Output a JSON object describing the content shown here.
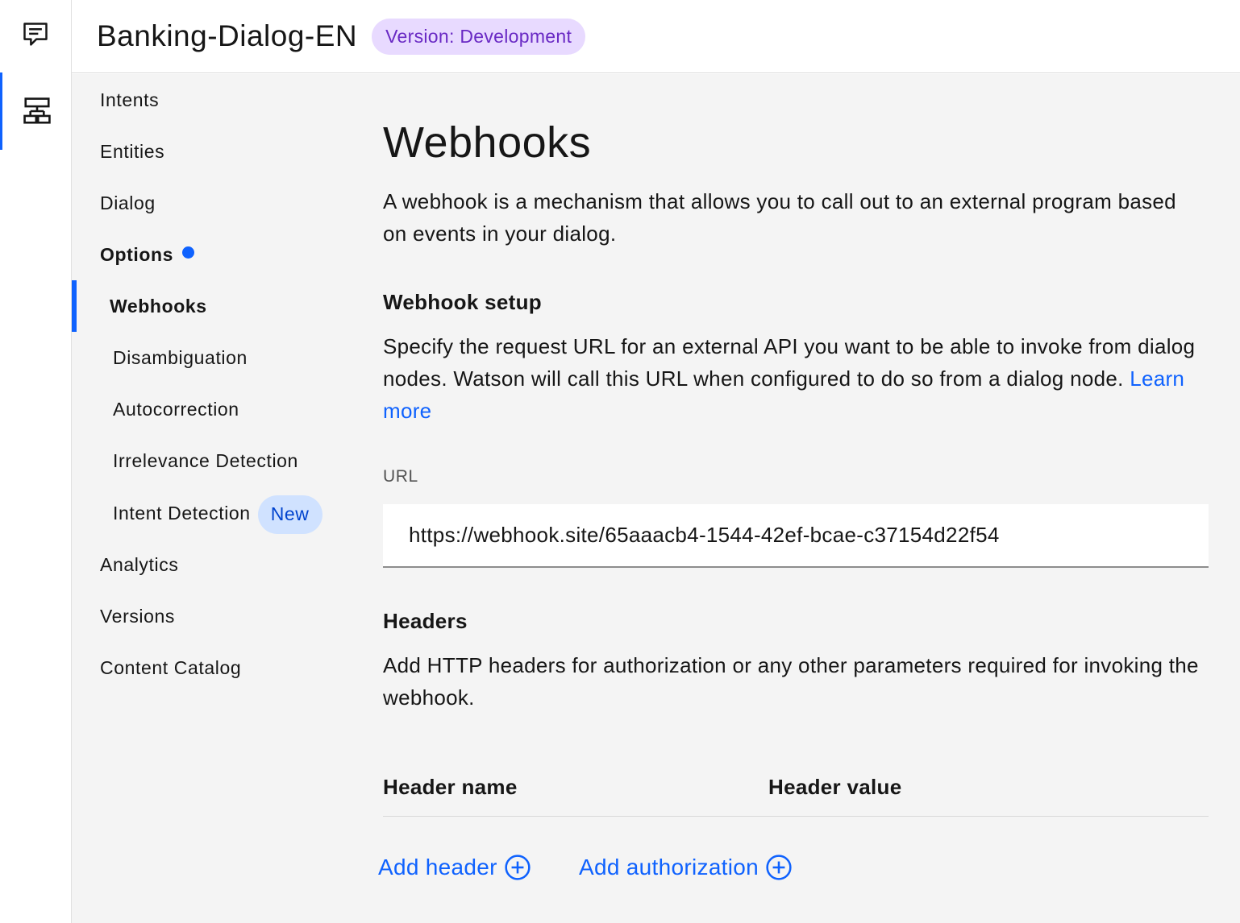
{
  "rail": {
    "items": [
      {
        "icon": "chat-icon"
      },
      {
        "icon": "flowchart-icon",
        "active": true
      }
    ]
  },
  "header": {
    "title": "Banking-Dialog-EN",
    "version_tag": "Version: Development"
  },
  "nav": {
    "intents": "Intents",
    "entities": "Entities",
    "dialog": "Dialog",
    "options": "Options",
    "webhooks": "Webhooks",
    "disambiguation": "Disambiguation",
    "autocorrection": "Autocorrection",
    "irrelevance": "Irrelevance Detection",
    "intent_detection": "Intent Detection",
    "new_tag": "New",
    "analytics": "Analytics",
    "versions": "Versions",
    "content_catalog": "Content Catalog"
  },
  "main": {
    "title": "Webhooks",
    "intro": "A webhook is a mechanism that allows you to call out to an external program based on events in your dialog.",
    "setup_heading": "Webhook setup",
    "setup_desc": "Specify the request URL for an external API you want to be able to invoke from dialog nodes. Watson will call this URL when configured to do so from a dialog node.",
    "learn_more": "Learn more",
    "url_label": "URL",
    "url_value": "https://webhook.site/65aaacb4-1544-42ef-bcae-c37154d22f54",
    "headers_heading": "Headers",
    "headers_desc": "Add HTTP headers for authorization or any other parameters required for invoking the webhook.",
    "col_name": "Header name",
    "col_value": "Header value",
    "add_header": "Add header",
    "add_authorization": "Add authorization"
  },
  "colors": {
    "accent": "#0f62fe",
    "version_tag_bg": "#e8daff",
    "version_tag_text": "#6929c4",
    "new_tag_bg": "#d0e2ff",
    "page_bg": "#f4f4f4"
  }
}
